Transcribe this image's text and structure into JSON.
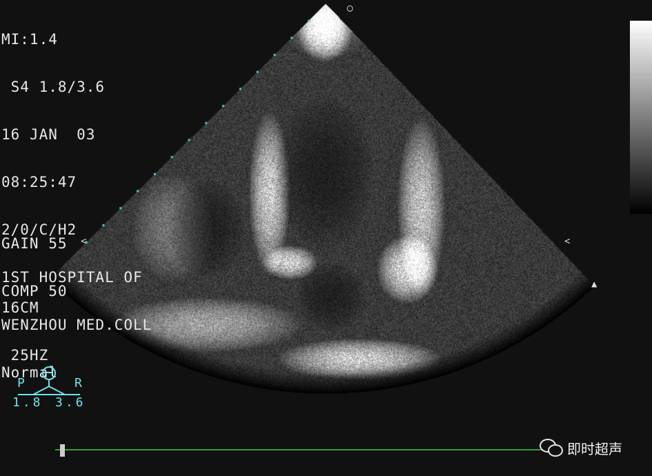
{
  "header": {
    "lines": [
      "MI:1.4",
      " S4 1.8/3.6",
      "16 JAN  03",
      "08:25:47",
      "2/0/C/H2",
      "1ST HOSPITAL OF",
      "WENZHOU MED.COLL",
      "Normal"
    ]
  },
  "settings": {
    "gain": "GAIN 55",
    "comp": "COMP 50"
  },
  "depth": {
    "depth": "16CM",
    "frame_rate": " 25HZ"
  },
  "probe": {
    "left_label": "P",
    "right_label": "R",
    "left_value": "1.8",
    "right_value": "3.6"
  },
  "watermark": {
    "text": "即时超声",
    "icon": "wechat-icon"
  },
  "colors": {
    "background": "#111111",
    "overlay_text": "#e8e8e8",
    "probe_text": "#6fe3ee",
    "timeline": "#3a9a3a",
    "depth_markers": "#4fd6e6"
  }
}
